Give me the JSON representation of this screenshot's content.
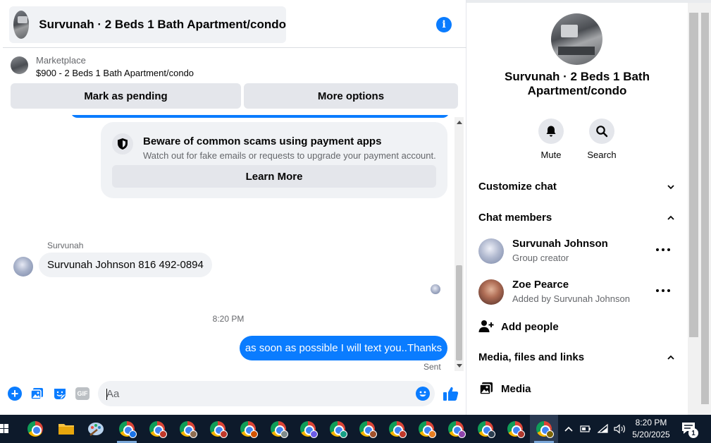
{
  "header": {
    "title": "Survunah · 2 Beds 1 Bath Apartment/condo"
  },
  "marketplace": {
    "label": "Marketplace",
    "listing": "$900 - 2 Beds 1 Bath Apartment/condo",
    "pending_button": "Mark as pending",
    "more_button": "More options"
  },
  "scam_notice": {
    "title": "Beware of common scams using payment apps",
    "subtitle": "Watch out for fake emails or requests to upgrade your payment account.",
    "button": "Learn More"
  },
  "messages": {
    "sender_name": "Survunah",
    "incoming_text": "Survunah Johnson 816 492-0894",
    "timestamp": "8:20 PM",
    "outgoing_text": "as soon as possible I will text you..Thanks",
    "status": "Sent"
  },
  "composer": {
    "placeholder": "Aa",
    "gif_label": "GIF"
  },
  "panel": {
    "title": "Survunah · 2 Beds 1 Bath Apartment/condo",
    "mute_label": "Mute",
    "search_label": "Search",
    "customize_label": "Customize chat",
    "members_label": "Chat members",
    "members": [
      {
        "name": "Survunah Johnson",
        "role": "Group creator"
      },
      {
        "name": "Zoe Pearce",
        "role": "Added by Survunah Johnson"
      }
    ],
    "add_people_label": "Add people",
    "media_section_label": "Media, files and links",
    "media_label": "Media"
  },
  "taskbar": {
    "time": "8:20 PM",
    "date": "5/20/2025",
    "notification_count": "1"
  },
  "colors": {
    "accent": "#0a7cff",
    "bubble_gray": "#f0f2f5",
    "button_gray": "#e4e6eb",
    "secondary_text": "#65676b",
    "taskbar": "#0d1a2b"
  }
}
